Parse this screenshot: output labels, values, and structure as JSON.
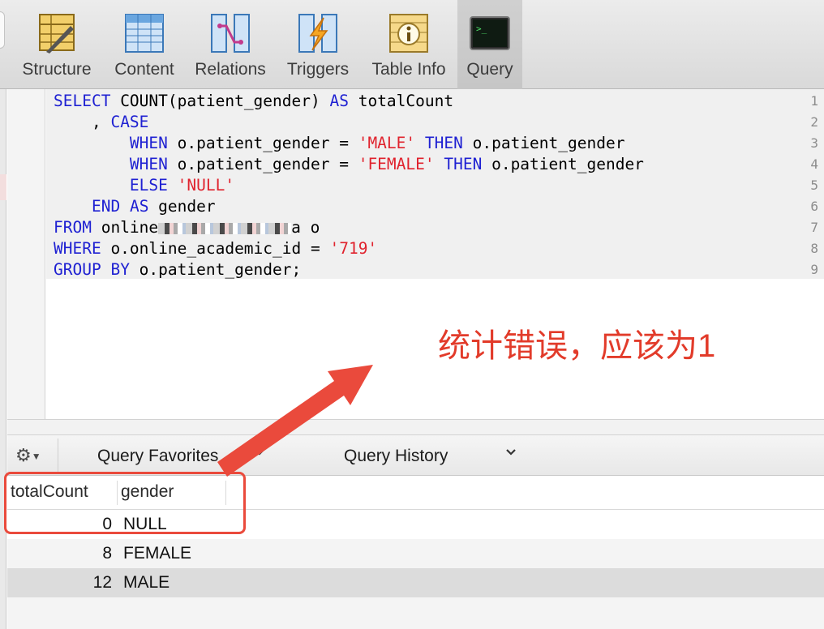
{
  "toolbar": {
    "tabs": [
      {
        "label": "Structure",
        "icon": "structure-icon"
      },
      {
        "label": "Content",
        "icon": "content-table-icon"
      },
      {
        "label": "Relations",
        "icon": "relations-icon"
      },
      {
        "label": "Triggers",
        "icon": "triggers-icon"
      },
      {
        "label": "Table Info",
        "icon": "table-info-icon"
      },
      {
        "label": "Query",
        "icon": "terminal-icon"
      }
    ],
    "active_tab": "Query"
  },
  "editor": {
    "line_numbers": [
      "1",
      "2",
      "3",
      "4",
      "5",
      "6",
      "7",
      "8",
      "9"
    ],
    "lines": [
      [
        {
          "t": "SELECT",
          "k": "kw"
        },
        {
          "t": " COUNT(patient_gender) "
        },
        {
          "t": "AS",
          "k": "kw"
        },
        {
          "t": " totalCount"
        }
      ],
      [
        {
          "t": "    , "
        },
        {
          "t": "CASE",
          "k": "kw"
        }
      ],
      [
        {
          "t": "        "
        },
        {
          "t": "WHEN",
          "k": "kw"
        },
        {
          "t": " o.patient_gender = "
        },
        {
          "t": "'MALE'",
          "k": "str"
        },
        {
          "t": " "
        },
        {
          "t": "THEN",
          "k": "kw"
        },
        {
          "t": " o.patient_gender"
        }
      ],
      [
        {
          "t": "        "
        },
        {
          "t": "WHEN",
          "k": "kw"
        },
        {
          "t": " o.patient_gender = "
        },
        {
          "t": "'FEMALE'",
          "k": "str"
        },
        {
          "t": " "
        },
        {
          "t": "THEN",
          "k": "kw"
        },
        {
          "t": " o.patient_gender"
        }
      ],
      [
        {
          "t": "        "
        },
        {
          "t": "ELSE",
          "k": "kw"
        },
        {
          "t": " "
        },
        {
          "t": "'NULL'",
          "k": "str"
        }
      ],
      [
        {
          "t": "    "
        },
        {
          "t": "END",
          "k": "kw"
        },
        {
          "t": " "
        },
        {
          "t": "AS",
          "k": "kw"
        },
        {
          "t": " gender"
        }
      ],
      [
        {
          "t": "FROM",
          "k": "kw"
        },
        {
          "t": " online"
        },
        {
          "t": "",
          "k": "blur"
        },
        {
          "t": "a o"
        }
      ],
      [
        {
          "t": "WHERE",
          "k": "kw"
        },
        {
          "t": " o.online_academic_id = "
        },
        {
          "t": "'719'",
          "k": "str"
        }
      ],
      [
        {
          "t": "GROUP",
          "k": "kw"
        },
        {
          "t": " "
        },
        {
          "t": "BY",
          "k": "kw"
        },
        {
          "t": " o.patient_gender;"
        }
      ]
    ]
  },
  "annotation": {
    "text": "统计错误，应该为1",
    "color": "#e23b2a"
  },
  "query_bar": {
    "favorites_label": "Query Favorites",
    "history_label": "Query History",
    "gear_icon": "gear-icon",
    "chevron": "⌄"
  },
  "results": {
    "columns": [
      "totalCount",
      "gender"
    ],
    "rows": [
      {
        "totalCount": "0",
        "gender": "NULL"
      },
      {
        "totalCount": "8",
        "gender": "FEMALE"
      },
      {
        "totalCount": "12",
        "gender": "MALE"
      }
    ],
    "selected_row": 2
  },
  "colors": {
    "keyword": "#1f21d2",
    "string": "#e0222d",
    "highlight_box": "#ea4a3c"
  }
}
